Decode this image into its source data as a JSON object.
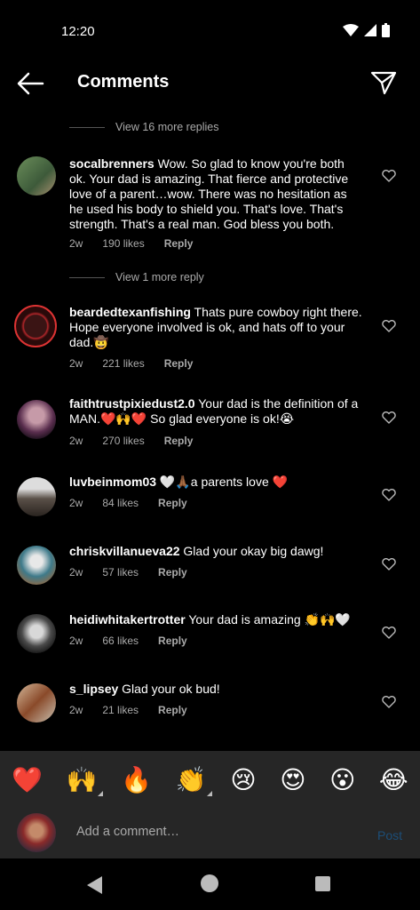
{
  "status_bar": {
    "time": "12:20"
  },
  "header": {
    "title": "Comments"
  },
  "replies": [
    {
      "label": "View 16 more replies"
    },
    {
      "label": "View 1 more reply"
    }
  ],
  "comments": [
    {
      "user": "socalbrenners",
      "text": " Wow. So glad to know you're both ok. Your dad is amazing. That fierce and protective love of a parent…wow. There was no hesitation as he used his body to shield you. That's love. That's strength. That's a real man. God bless you both.",
      "time": "2w",
      "likes": "190 likes",
      "reply": "Reply"
    },
    {
      "user": "beardedtexanfishing",
      "text": " Thats pure cowboy right there. Hope everyone involved is ok, and hats off to your dad.🤠",
      "time": "2w",
      "likes": "221 likes",
      "reply": "Reply"
    },
    {
      "user": "faithtrustpixiedust2.0",
      "text": " Your dad is the definition of a MAN.❤️🙌❤️ So glad everyone is ok!😭",
      "time": "2w",
      "likes": "270 likes",
      "reply": "Reply"
    },
    {
      "user": "luvbeinmom03",
      "text": " 🤍🙏🏾a parents love ❤️",
      "time": "2w",
      "likes": "84 likes",
      "reply": "Reply"
    },
    {
      "user": "chriskvillanueva22",
      "text": " Glad your okay big dawg!",
      "time": "2w",
      "likes": "57 likes",
      "reply": "Reply"
    },
    {
      "user": "heidiwhitakertrotter",
      "text": " Your dad is amazing 👏🙌🤍",
      "time": "2w",
      "likes": "66 likes",
      "reply": "Reply"
    },
    {
      "user": "s_lipsey",
      "text": " Glad your ok bud!",
      "time": "2w",
      "likes": "21 likes",
      "reply": "Reply"
    }
  ],
  "emoji_bar": [
    "❤️",
    "🙌",
    "🔥",
    "👏",
    "😢",
    "😍",
    "😮",
    "😂"
  ],
  "compose": {
    "placeholder": "Add a comment…",
    "post_label": "Post"
  },
  "colors": {
    "background": "#000000",
    "panel": "#262626",
    "secondary_text": "#aaaaaa",
    "post_disabled": "#1c4e78"
  }
}
